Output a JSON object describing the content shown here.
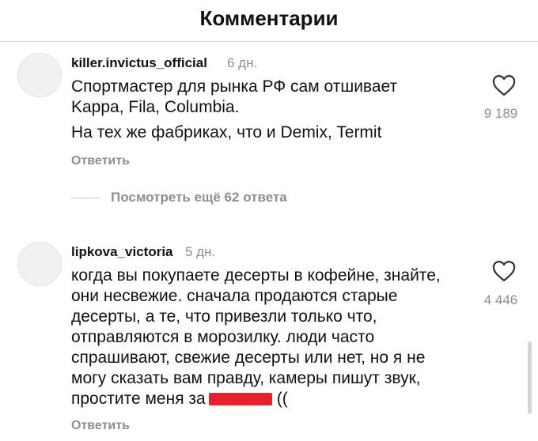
{
  "header": {
    "title": "Комментарии"
  },
  "comments": [
    {
      "username": "killer.invictus_official",
      "time": "6 дн.",
      "lines": [
        "Спортмастер для рынка РФ сам отшивает",
        "Kappa, Fila, Columbia.",
        "На тех же фабриках, что и Demix, Termit"
      ],
      "likes": "9 189",
      "reply_label": "Ответить",
      "view_replies": "Посмотреть ещё 62 ответа"
    },
    {
      "username": "lipkova_victoria",
      "time": "5 дн.",
      "lines": [
        "когда вы покупаете десерты в кофейне, знайте,",
        "они несвежие. сначала продаются старые",
        "десерты, а те, что привезли только что,",
        "отправляются в морозилку. люди часто",
        "спрашивают, свежие десерты или нет, но я не",
        "могу сказать вам правду, камеры пишут звук,"
      ],
      "last_line_start": "простите меня за",
      "last_line_end": "((",
      "likes": "4 446",
      "reply_label": "Ответить"
    }
  ],
  "icons": {
    "like": "heart-outline-icon"
  },
  "colors": {
    "secondary_text": "#8e8e8e",
    "redaction": "#e8202b"
  }
}
